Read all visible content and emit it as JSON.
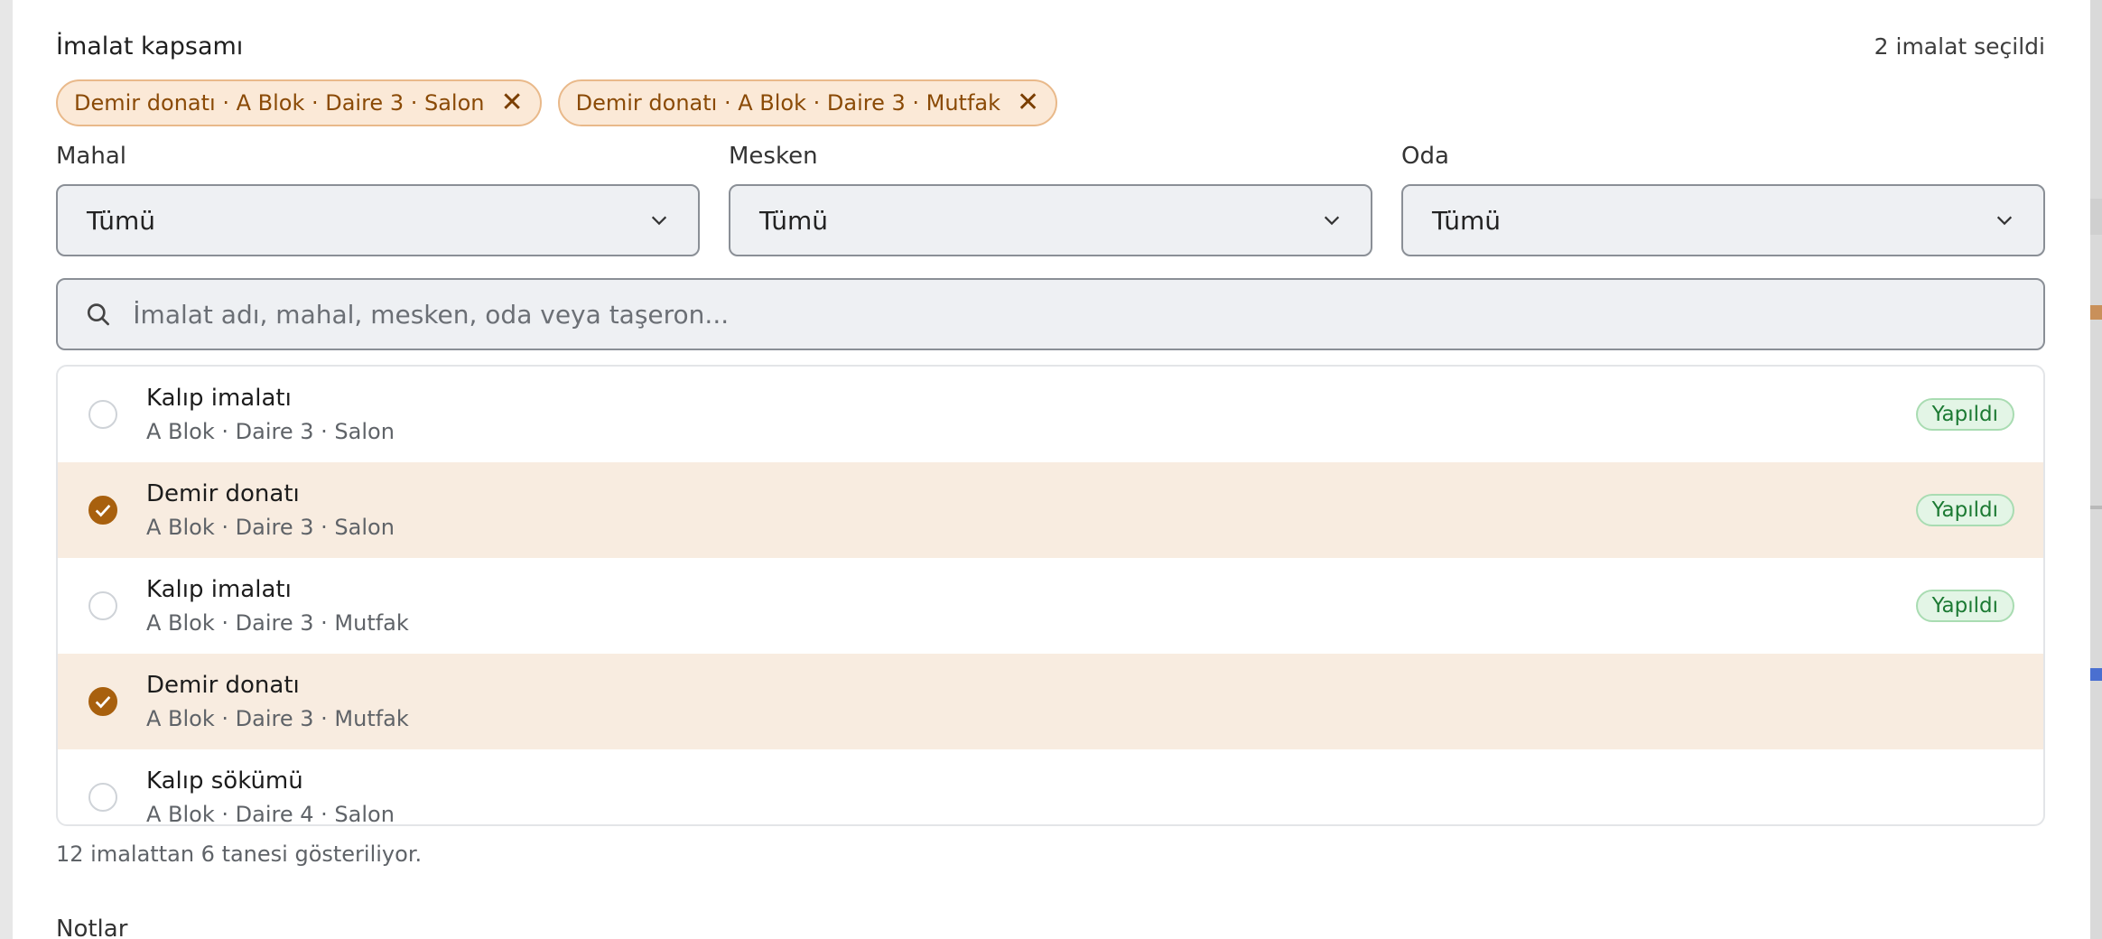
{
  "section": {
    "title": "İmalat kapsamı",
    "selected_count": "2 imalat seçildi"
  },
  "chips": [
    {
      "label": "Demir donatı · A Blok · Daire 3 · Salon"
    },
    {
      "label": "Demir donatı · A Blok · Daire 3 · Mutfak"
    }
  ],
  "filters": {
    "mahal": {
      "label": "Mahal",
      "value": "Tümü"
    },
    "mesken": {
      "label": "Mesken",
      "value": "Tümü"
    },
    "oda": {
      "label": "Oda",
      "value": "Tümü"
    }
  },
  "search": {
    "placeholder": "İmalat adı, mahal, mesken, oda veya taşeron..."
  },
  "items": [
    {
      "title": "Kalıp imalatı",
      "subtitle": "A Blok · Daire 3 · Salon",
      "badge": "Yapıldı",
      "selected": false
    },
    {
      "title": "Demir donatı",
      "subtitle": "A Blok · Daire 3 · Salon",
      "badge": "Yapıldı",
      "selected": true
    },
    {
      "title": "Kalıp imalatı",
      "subtitle": "A Blok · Daire 3 · Mutfak",
      "badge": "Yapıldı",
      "selected": false
    },
    {
      "title": "Demir donatı",
      "subtitle": "A Blok · Daire 3 · Mutfak",
      "badge": "",
      "selected": true
    },
    {
      "title": "Kalıp sökümü",
      "subtitle": "A Blok · Daire 4 · Salon",
      "badge": "",
      "selected": false
    }
  ],
  "footer_note": "12 imalattan 6 tanesi gösteriliyor.",
  "notes_label": "Notlar",
  "colors": {
    "accent": "#a8600e",
    "chip_bg": "#fbe9d7",
    "selected_row_bg": "#f8ece0",
    "badge_green": "#1c7a33"
  }
}
